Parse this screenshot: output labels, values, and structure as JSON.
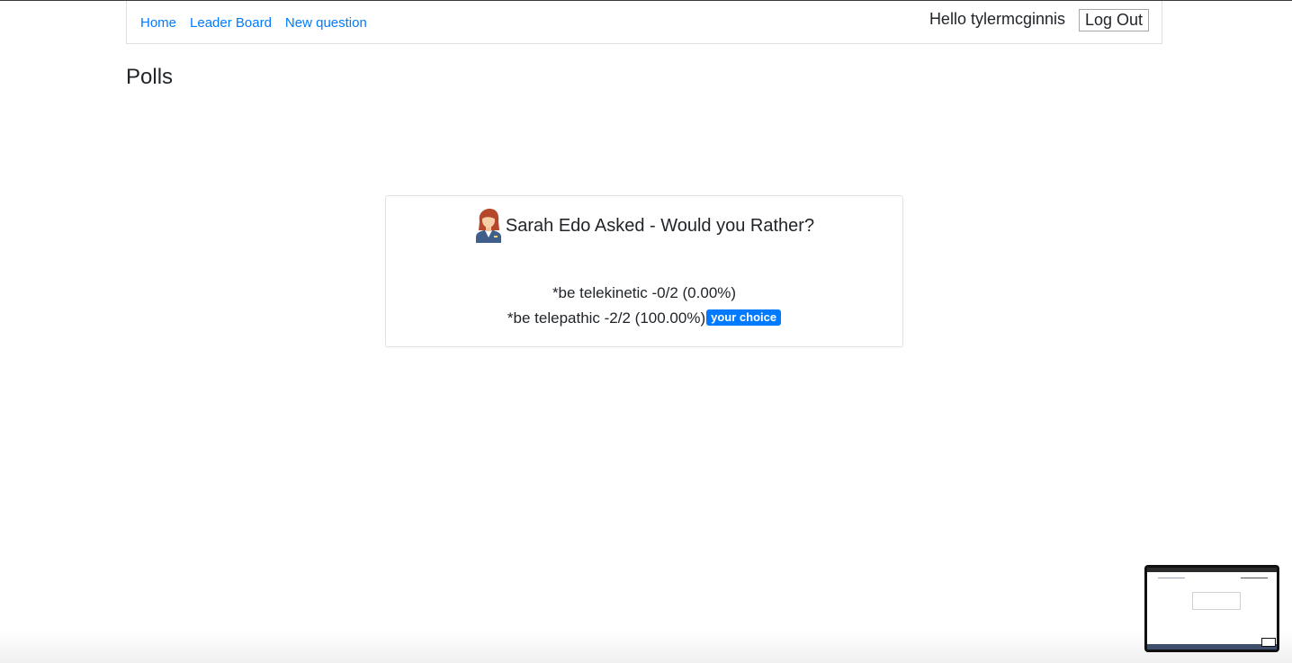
{
  "nav": {
    "links": [
      {
        "label": "Home"
      },
      {
        "label": "Leader Board"
      },
      {
        "label": "New question"
      }
    ],
    "greeting": "Hello tylermcginnis",
    "logout_label": "Log Out"
  },
  "page": {
    "title": "Polls"
  },
  "poll": {
    "avatar_icon": "woman-avatar-icon",
    "title": "Sarah Edo Asked - Would you Rather?",
    "options": [
      {
        "text": "*be telekinetic -0/2 (0.00%)",
        "votes": 0,
        "total": 2,
        "percent": 0.0,
        "chosen": false
      },
      {
        "text": "*be telepathic -2/2 (100.00%)",
        "votes": 2,
        "total": 2,
        "percent": 100.0,
        "chosen": true
      }
    ],
    "badge_label": "your choice"
  },
  "colors": {
    "link": "#007bff",
    "badge_bg": "#007bff",
    "text": "#212529",
    "border": "#dee2e6"
  }
}
